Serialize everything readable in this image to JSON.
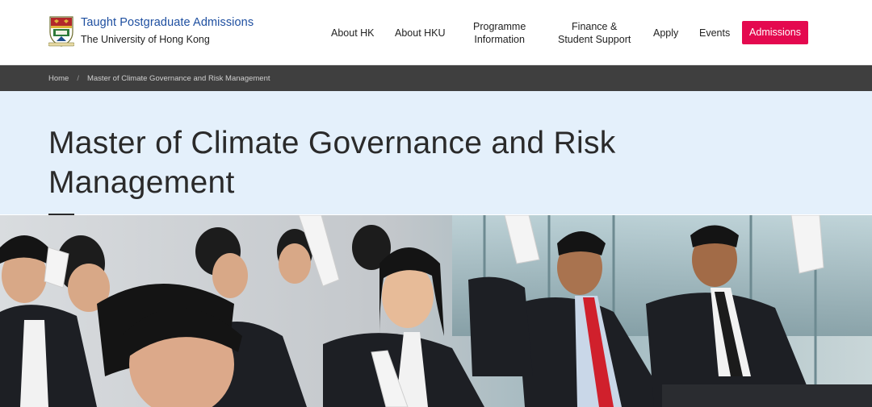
{
  "header": {
    "title": "Taught Postgraduate Admissions",
    "subtitle": "The University of Hong Kong",
    "logo_icon": "hku-crest-icon"
  },
  "nav": {
    "items": [
      {
        "label": "About HK"
      },
      {
        "label": "About HKU"
      },
      {
        "label": "Programme\nInformation"
      },
      {
        "label": "Finance &\nStudent Support"
      },
      {
        "label": "Apply"
      },
      {
        "label": "Events"
      }
    ],
    "cta": "Admissions",
    "cta_color": "#e4094f"
  },
  "breadcrumb": {
    "items": [
      "Home",
      "Master of Climate Governance and Risk Management"
    ],
    "separator": "/"
  },
  "page": {
    "title": "Master of Climate Governance and Risk Management",
    "title_bg": "#e4f0fb"
  },
  "hero_image": {
    "description_icon": "students-classroom-photo"
  }
}
